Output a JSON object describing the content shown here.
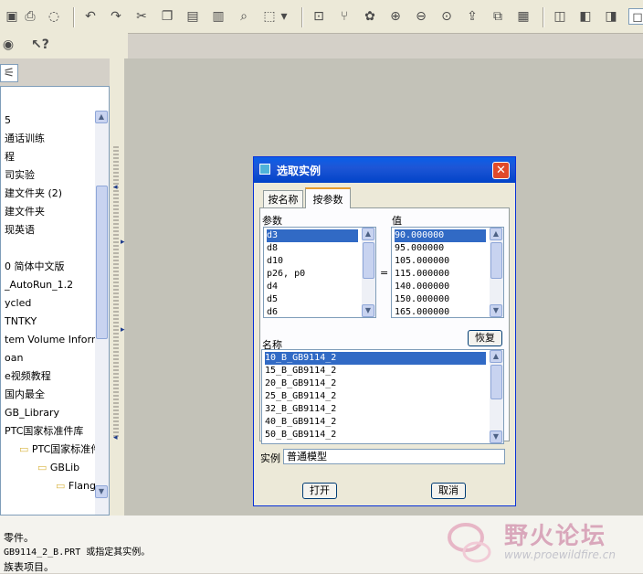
{
  "toolbar": {
    "icons": [
      "open-icon",
      "save-icon",
      "undo-icon",
      "redo-icon",
      "cut-icon",
      "copy-icon",
      "paste-icon",
      "paste-special-icon",
      "find-icon",
      "select-box-icon",
      "regenerate-icon",
      "model-tree-icon",
      "repaint-icon",
      "zoom-in-icon",
      "zoom-out-icon",
      "refit-icon",
      "orient-icon",
      "saved-views-icon",
      "layers-icon",
      "view-iso-icon",
      "view-front-icon",
      "view-top-icon",
      "shaded-icon"
    ],
    "help_icon": "whats-this-icon"
  },
  "tree": {
    "items": [
      "5",
      "通话训练",
      "程",
      "司实验",
      "建文件夹 (2)",
      "建文件夹",
      "现英语",
      "",
      "0 简体中文版",
      "_AutoRun_1.2",
      "ycled",
      "TNTKY",
      "tem Volume Inform",
      "oan",
      "e视频教程",
      "国内最全",
      "GB_Library",
      "PTC国家标准件库",
      "PTC国家标准件",
      "GBLib",
      "Flange"
    ]
  },
  "status": {
    "lines": [
      "零件。",
      "GB9114_2_B.PRT 或指定其实例。",
      "族表项目。"
    ]
  },
  "watermark": {
    "text": "野火论坛",
    "url": "www.proewildfire.cn"
  },
  "dialog": {
    "title": "选取实例",
    "tabs": [
      "按名称",
      "按参数"
    ],
    "param_label": "参数",
    "value_label": "值",
    "equals": "=",
    "params": [
      "d3",
      "d8",
      "d10",
      "p26, p0",
      "d4",
      "d5",
      "d6"
    ],
    "values": [
      "90.000000",
      "95.000000",
      "105.000000",
      "115.000000",
      "140.000000",
      "150.000000",
      "165.000000"
    ],
    "reset_button": "恢复",
    "name_label": "名称",
    "names": [
      "10_B_GB9114_2",
      "15_B_GB9114_2",
      "20_B_GB9114_2",
      "25_B_GB9114_2",
      "32_B_GB9114_2",
      "40_B_GB9114_2",
      "50_B_GB9114_2"
    ],
    "instance_label": "实例",
    "instance_value": "普通模型",
    "open_button": "打开",
    "cancel_button": "取消"
  }
}
